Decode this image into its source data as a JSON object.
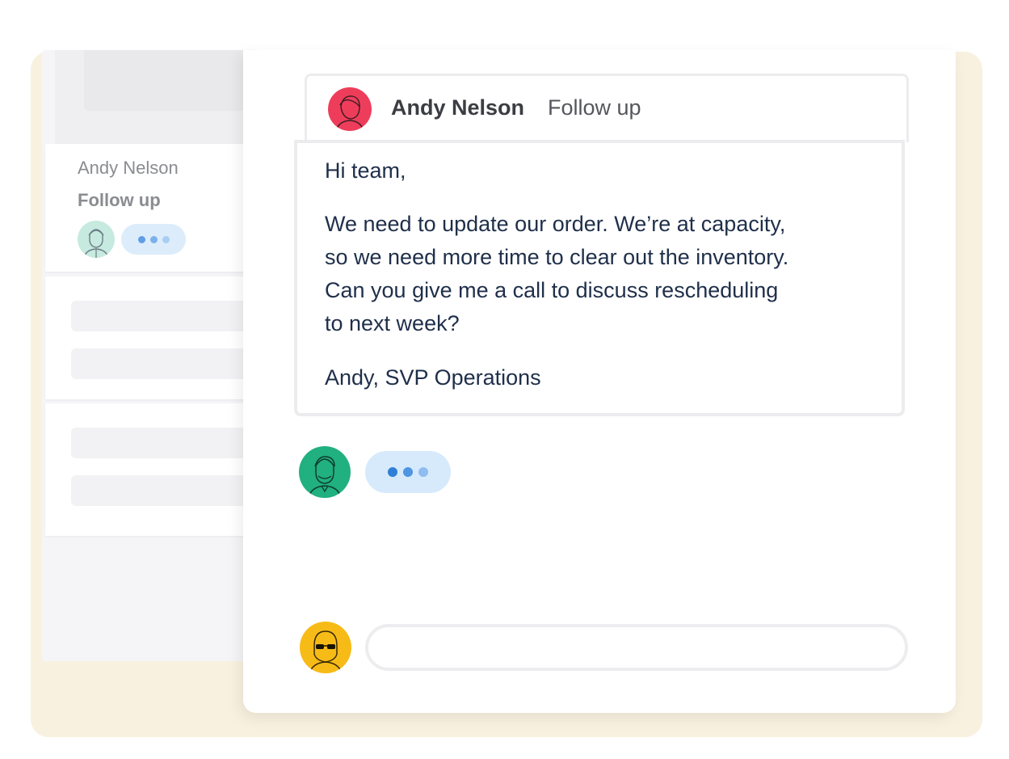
{
  "colors": {
    "accent_text": "#1f2f4a",
    "typing_dot_dark": "#2f7fd6",
    "typing_dot_mid": "#4e95e2",
    "typing_dot_light": "#8fbdf0",
    "sender_avatar": "#ee3d5a",
    "reply_avatar": "#21b07f",
    "me_avatar": "#f7bb18"
  },
  "sidebar": {
    "conversation": {
      "from": "Andy Nelson",
      "subject": "Follow up",
      "avatar_icon": "man-avatar-icon",
      "status": "typing-indicator"
    }
  },
  "thread": {
    "header": {
      "sender_name": "Andy Nelson",
      "subject": "Follow up",
      "avatar_icon": "woman-avatar-icon"
    },
    "message": {
      "greeting": "Hi team,",
      "body": "We need to update our order. We’re at capacity,\nso we need more time to clear out the inventory.\nCan you give me a call to discuss rescheduling\nto next week?",
      "signature": "Andy, SVP Operations"
    },
    "reply_typing": {
      "avatar_icon": "man-beard-avatar-icon",
      "status": "typing-indicator"
    }
  },
  "composer": {
    "avatar_icon": "sunglasses-avatar-icon",
    "input_value": "",
    "input_placeholder": ""
  }
}
